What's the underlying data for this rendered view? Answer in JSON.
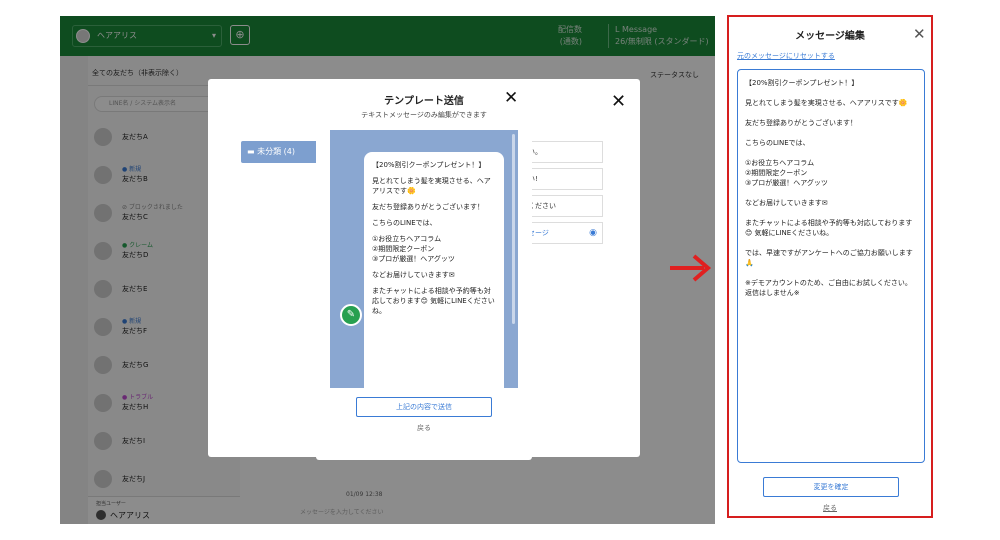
{
  "header": {
    "account_name": "ヘアアリス",
    "stat_sent": "配信数",
    "stat_sent_sub": "(通数)",
    "stat_message": "L Message",
    "stat_plan": "26/無制限 (スタンダード)"
  },
  "friends_panel": {
    "filter_label": "全ての友だち（非表示除く）",
    "search_placeholder": "LINE名 / システム表示名",
    "friends": [
      {
        "name": "友だちA",
        "tag": ""
      },
      {
        "name": "友だちB",
        "tag": "● 新規"
      },
      {
        "name": "友だちC",
        "tag": "⊘ ブロックされました"
      },
      {
        "name": "友だちD",
        "tag": "● クレーム"
      },
      {
        "name": "友だちE",
        "tag": ""
      },
      {
        "name": "友だちF",
        "tag": "● 新規"
      },
      {
        "name": "友だちG",
        "tag": ""
      },
      {
        "name": "友だちH",
        "tag": "● トラブル"
      },
      {
        "name": "友だちI",
        "tag": ""
      },
      {
        "name": "友だちJ",
        "tag": ""
      }
    ],
    "owner_small": "担当ユーザー",
    "owner_name": "ヘアアリス"
  },
  "chat": {
    "timestamp": "01/09 12:38",
    "input_placeholder": "メッセージを入力してください"
  },
  "right_panel": {
    "title": "ステータスなし"
  },
  "outer_dialog": {
    "folder": "未分類 (4)",
    "rows": [
      "い。",
      "い!",
      "ください",
      "セージ"
    ]
  },
  "template_dialog": {
    "title": "テンプレート送信",
    "subtitle": "テキストメッセージのみ編集ができます",
    "bubble_lines": [
      "【20%割引クーポンプレゼント！】",
      "見とれてしまう髪を実現させる、ヘアアリスです🌼",
      "友だち登録ありがとうございます！",
      "こちらのLINEでは、",
      "①お役立ちヘアコラム\n②期間限定クーポン\n③プロが厳選！ヘアグッツ",
      "などお届けしていきます✉",
      "またチャットによる相談や予約等も対応しております😊 気軽にLINEくださいね。"
    ],
    "send_label": "上記の内容で送信",
    "back_label": "戻る"
  },
  "editor": {
    "title": "メッセージ編集",
    "reset_label": "元のメッセージにリセットする",
    "paragraphs": [
      "【20%割引クーポンプレゼント！】",
      "見とれてしまう髪を実現させる、ヘアアリスです🌼",
      "友だち登録ありがとうございます！",
      "こちらのLINEでは、",
      "①お役立ちヘアコラム\n②期間限定クーポン\n③プロが厳選！ヘアグッツ",
      "などお届けしていきます✉",
      "またチャットによる相談や予約等も対応しております😊 気軽にLINEくださいね。",
      "では、早速ですがアンケートへのご協力お願いします🙏",
      "※デモアカウントのため、ご自由にお試しください。返信はしません※"
    ],
    "confirm_label": "変更を確定",
    "back_label": "戻る"
  },
  "colors": {
    "header_green": "#1a8a3a",
    "accent_blue": "#3a7bd5",
    "highlight_red": "#d61e1e"
  }
}
